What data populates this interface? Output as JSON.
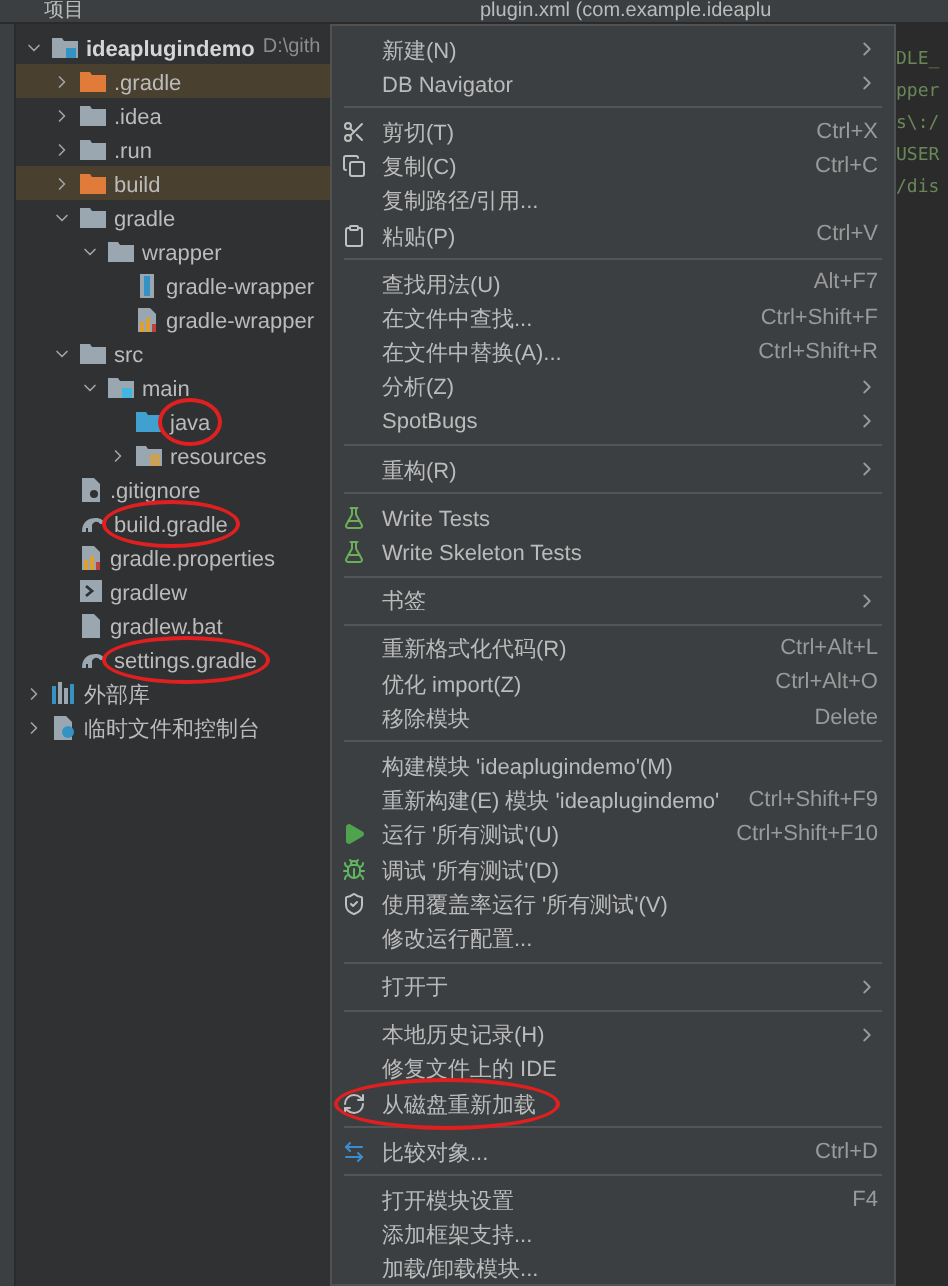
{
  "top_bar": {
    "tab": "项目",
    "editor_tab": "plugin.xml (com.example.ideaplu"
  },
  "tree": [
    {
      "label": "ideaplugindemo",
      "path": "D:\\gith",
      "kind": "module",
      "expanded": true,
      "highlighted": false,
      "circled": false,
      "children": [
        {
          "label": ".gradle",
          "kind": "excluded-folder",
          "expanded": false,
          "highlighted": true,
          "circled": false
        },
        {
          "label": ".idea",
          "kind": "folder",
          "expanded": false,
          "highlighted": false,
          "circled": false
        },
        {
          "label": ".run",
          "kind": "folder",
          "expanded": false,
          "highlighted": false,
          "circled": false
        },
        {
          "label": "build",
          "kind": "excluded-folder",
          "expanded": false,
          "highlighted": true,
          "circled": false
        },
        {
          "label": "gradle",
          "kind": "folder",
          "expanded": true,
          "highlighted": false,
          "circled": false,
          "children": [
            {
              "label": "wrapper",
              "kind": "folder",
              "expanded": true,
              "highlighted": false,
              "circled": false,
              "children": [
                {
                  "label": "gradle-wrapper",
                  "kind": "jar",
                  "highlighted": false,
                  "circled": false
                },
                {
                  "label": "gradle-wrapper",
                  "kind": "properties",
                  "highlighted": false,
                  "circled": false
                }
              ]
            }
          ]
        },
        {
          "label": "src",
          "kind": "folder",
          "expanded": true,
          "highlighted": false,
          "circled": false,
          "children": [
            {
              "label": "main",
              "kind": "module-folder",
              "expanded": true,
              "highlighted": false,
              "circled": false,
              "children": [
                {
                  "label": "java",
                  "kind": "source-folder",
                  "highlighted": false,
                  "circled": true
                },
                {
                  "label": "resources",
                  "kind": "resources-folder",
                  "expanded": false,
                  "highlighted": false,
                  "circled": false
                }
              ]
            }
          ]
        },
        {
          "label": ".gitignore",
          "kind": "ignore",
          "highlighted": false,
          "circled": false
        },
        {
          "label": "build.gradle",
          "kind": "gradle",
          "highlighted": false,
          "circled": true
        },
        {
          "label": "gradle.properties",
          "kind": "properties",
          "highlighted": false,
          "circled": false
        },
        {
          "label": "gradlew",
          "kind": "shell",
          "highlighted": false,
          "circled": false
        },
        {
          "label": "gradlew.bat",
          "kind": "file",
          "highlighted": false,
          "circled": false
        },
        {
          "label": "settings.gradle",
          "kind": "gradle",
          "highlighted": false,
          "circled": true
        }
      ]
    },
    {
      "label": "外部库",
      "kind": "library",
      "expanded": false,
      "highlighted": false,
      "circled": false
    },
    {
      "label": "临时文件和控制台",
      "kind": "scratch",
      "expanded": false,
      "highlighted": false,
      "circled": false
    }
  ],
  "context_menu": [
    {
      "kind": "item",
      "label": "新建(N)",
      "submenu": true
    },
    {
      "kind": "item",
      "label": "DB Navigator",
      "submenu": true
    },
    {
      "kind": "separator"
    },
    {
      "kind": "cut",
      "label": "剪切(T)",
      "shortcut": "Ctrl+X"
    },
    {
      "kind": "copy",
      "label": "复制(C)",
      "shortcut": "Ctrl+C"
    },
    {
      "kind": "item",
      "label": "复制路径/引用..."
    },
    {
      "kind": "paste",
      "label": "粘贴(P)",
      "shortcut": "Ctrl+V"
    },
    {
      "kind": "separator"
    },
    {
      "kind": "item",
      "label": "查找用法(U)",
      "shortcut": "Alt+F7"
    },
    {
      "kind": "item",
      "label": "在文件中查找...",
      "shortcut": "Ctrl+Shift+F"
    },
    {
      "kind": "item",
      "label": "在文件中替换(A)...",
      "shortcut": "Ctrl+Shift+R"
    },
    {
      "kind": "item",
      "label": "分析(Z)",
      "submenu": true
    },
    {
      "kind": "item",
      "label": "SpotBugs",
      "submenu": true
    },
    {
      "kind": "separator"
    },
    {
      "kind": "item",
      "label": "重构(R)",
      "submenu": true
    },
    {
      "kind": "separator"
    },
    {
      "kind": "test",
      "label": "Write Tests"
    },
    {
      "kind": "test",
      "label": "Write Skeleton Tests"
    },
    {
      "kind": "separator"
    },
    {
      "kind": "item",
      "label": "书签",
      "submenu": true
    },
    {
      "kind": "separator"
    },
    {
      "kind": "item",
      "label": "重新格式化代码(R)",
      "shortcut": "Ctrl+Alt+L"
    },
    {
      "kind": "item",
      "label": "优化 import(Z)",
      "shortcut": "Ctrl+Alt+O"
    },
    {
      "kind": "item",
      "label": "移除模块",
      "shortcut": "Delete"
    },
    {
      "kind": "separator"
    },
    {
      "kind": "item",
      "label": "构建模块 'ideaplugindemo'(M)"
    },
    {
      "kind": "item",
      "label": "重新构建(E) 模块 'ideaplugindemo'",
      "shortcut": "Ctrl+Shift+F9"
    },
    {
      "kind": "run",
      "label": "运行 '所有测试'(U)",
      "shortcut": "Ctrl+Shift+F10"
    },
    {
      "kind": "debug",
      "label": "调试 '所有测试'(D)"
    },
    {
      "kind": "coverage",
      "label": "使用覆盖率运行 '所有测试'(V)"
    },
    {
      "kind": "item",
      "label": "修改运行配置..."
    },
    {
      "kind": "separator"
    },
    {
      "kind": "item",
      "label": "打开于",
      "submenu": true
    },
    {
      "kind": "separator"
    },
    {
      "kind": "item",
      "label": "本地历史记录(H)",
      "submenu": true
    },
    {
      "kind": "item",
      "label": "修复文件上的 IDE"
    },
    {
      "kind": "reload",
      "label": "从磁盘重新加载",
      "circled": true
    },
    {
      "kind": "separator"
    },
    {
      "kind": "compare",
      "label": "比较对象...",
      "shortcut": "Ctrl+D"
    },
    {
      "kind": "separator"
    },
    {
      "kind": "item",
      "label": "打开模块设置",
      "shortcut": "F4"
    },
    {
      "kind": "item",
      "label": "添加框架支持..."
    },
    {
      "kind": "item",
      "label": "加载/卸载模块..."
    }
  ],
  "editor_lines": [
    "DLE_",
    "pper",
    "s\\:/",
    "USER",
    "/dis"
  ]
}
